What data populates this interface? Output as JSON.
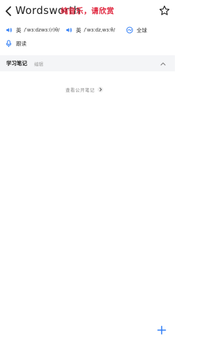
{
  "header": {
    "title": "Wordsworth",
    "overlay_text": "纯音乐，请欣赏"
  },
  "pronunciation": {
    "uk": {
      "label": "英",
      "phonetic": "/ˈwɜːdzwɜː(r)θ/"
    },
    "us": {
      "label": "英",
      "phonetic": "/ˈwɜːdzˌwɜːθ/"
    },
    "global": {
      "label": "全球"
    }
  },
  "follow_read": {
    "label": "跟读"
  },
  "notes": {
    "title": "学习笔记",
    "edit_label": "编辑"
  },
  "public_notes": {
    "label": "查看公开笔记"
  },
  "colors": {
    "accent": "#2f7df6",
    "overlay": "#e0243c",
    "section_bg": "#f4f5f7"
  },
  "icons": {
    "back": "chevron-left-icon",
    "favorite": "star-icon",
    "speaker": "speaker-icon",
    "globe": "globe-icon",
    "microphone": "microphone-icon",
    "collapse": "chevron-up-icon",
    "more": "chevron-right-icon",
    "add": "plus-icon"
  }
}
